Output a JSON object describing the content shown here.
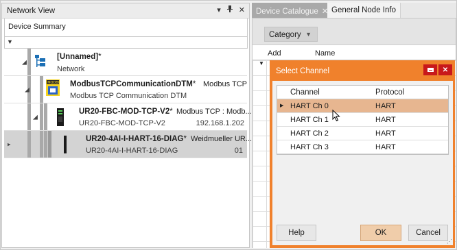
{
  "network_view": {
    "title": "Network View",
    "pin_glyph": "▾ ⊥",
    "close_glyph": "✕",
    "column_header": "Device Summary",
    "nodes": [
      {
        "title": "[Unnamed]",
        "star": "*",
        "subtitle": "Network",
        "protocol": "",
        "address": "",
        "icon": "network-tree-icon"
      },
      {
        "title": "ModbusTCPCommunicationDTM",
        "star": "*",
        "subtitle": "Modbus TCP Communication DTM",
        "protocol": "Modbus TCP",
        "address": "",
        "icon": "modbus-logo-icon"
      },
      {
        "title": "UR20-FBC-MOD-TCP-V2",
        "star": "*",
        "subtitle": "UR20-FBC-MOD-TCP-V2",
        "protocol": "Modbus TCP : Modb...",
        "address": "192.168.1.202",
        "icon": "bus-coupler-icon"
      },
      {
        "title": "UR20-4AI-I-HART-16-DIAG",
        "star": "*",
        "subtitle": "UR20-4AI-I-HART-16-DIAG",
        "protocol": "Weidmueller UR...",
        "address": "01",
        "icon": "io-module-icon"
      }
    ]
  },
  "tabs": [
    {
      "label": "Device Catalogue",
      "close": "✕",
      "active": true
    },
    {
      "label": "General Node Info",
      "active": false
    }
  ],
  "catalogue": {
    "category_label": "Category",
    "columns": [
      "Add",
      "Name"
    ]
  },
  "dialog": {
    "title": "Select Channel",
    "columns": [
      "Channel",
      "Protocol"
    ],
    "rows": [
      {
        "channel": "HART Ch 0",
        "protocol": "HART",
        "selected": true
      },
      {
        "channel": "HART Ch 1",
        "protocol": "HART",
        "selected": false
      },
      {
        "channel": "HART Ch 2",
        "protocol": "HART",
        "selected": false
      },
      {
        "channel": "HART Ch 3",
        "protocol": "HART",
        "selected": false
      }
    ],
    "buttons": {
      "help": "Help",
      "ok": "OK",
      "cancel": "Cancel"
    },
    "close_glyph": "✕"
  },
  "colors": {
    "dialog_accent": "#f0812c",
    "dialog_close": "#c8181b",
    "selected_row": "#e7b690",
    "active_tab": "#a9a9a9"
  }
}
